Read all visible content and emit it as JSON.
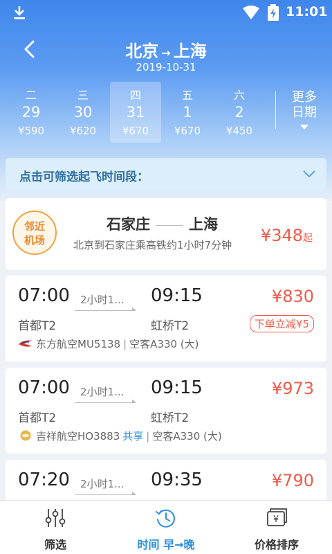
{
  "status": {
    "time": "11:01"
  },
  "header": {
    "from": "北京",
    "arrow": "→",
    "to": "上海",
    "date": "2019-10-31"
  },
  "days": [
    {
      "weekday": "二",
      "day": "29",
      "price": "¥590",
      "selected": false
    },
    {
      "weekday": "三",
      "day": "30",
      "price": "¥620",
      "selected": false
    },
    {
      "weekday": "四",
      "day": "31",
      "price": "¥670",
      "selected": true
    },
    {
      "weekday": "五",
      "day": "1",
      "price": "¥670",
      "selected": false
    },
    {
      "weekday": "六",
      "day": "2",
      "price": "¥450",
      "selected": false
    }
  ],
  "more_dates": {
    "line1": "更多",
    "line2": "日期"
  },
  "filter": {
    "label": "点击可筛选起飞时间段："
  },
  "nearby": {
    "badge_line1": "邻近",
    "badge_line2": "机场",
    "from": "石家庄",
    "to": "上海",
    "desc": "北京到石家庄乘高铁约1小时7分钟",
    "price": "¥348",
    "price_suffix": "起"
  },
  "flights": [
    {
      "dep_time": "07:00",
      "duration": "2小时1...",
      "arr_time": "09:15",
      "price": "¥830",
      "dep_airport": "首都T2",
      "arr_airport": "虹桥T2",
      "promo": "下单立减¥5",
      "airline": "东方航空MU5138",
      "shared": "",
      "aircraft": "空客A330 (大)"
    },
    {
      "dep_time": "07:00",
      "duration": "2小时1...",
      "arr_time": "09:15",
      "price": "¥973",
      "dep_airport": "首都T2",
      "arr_airport": "虹桥T2",
      "promo": "",
      "airline": "吉祥航空HO3883",
      "shared": "共享",
      "aircraft": "空客A330 (大)"
    },
    {
      "dep_time": "07:20",
      "duration": "2小时1...",
      "arr_time": "09:35",
      "price": "¥790"
    }
  ],
  "tabs": [
    {
      "label": "筛选"
    },
    {
      "label": "时间 早→晚"
    },
    {
      "label": "价格排序"
    }
  ],
  "colors": {
    "accent": "#2a8fdc",
    "price": "#ef5a48",
    "header": "#3f86ec"
  }
}
